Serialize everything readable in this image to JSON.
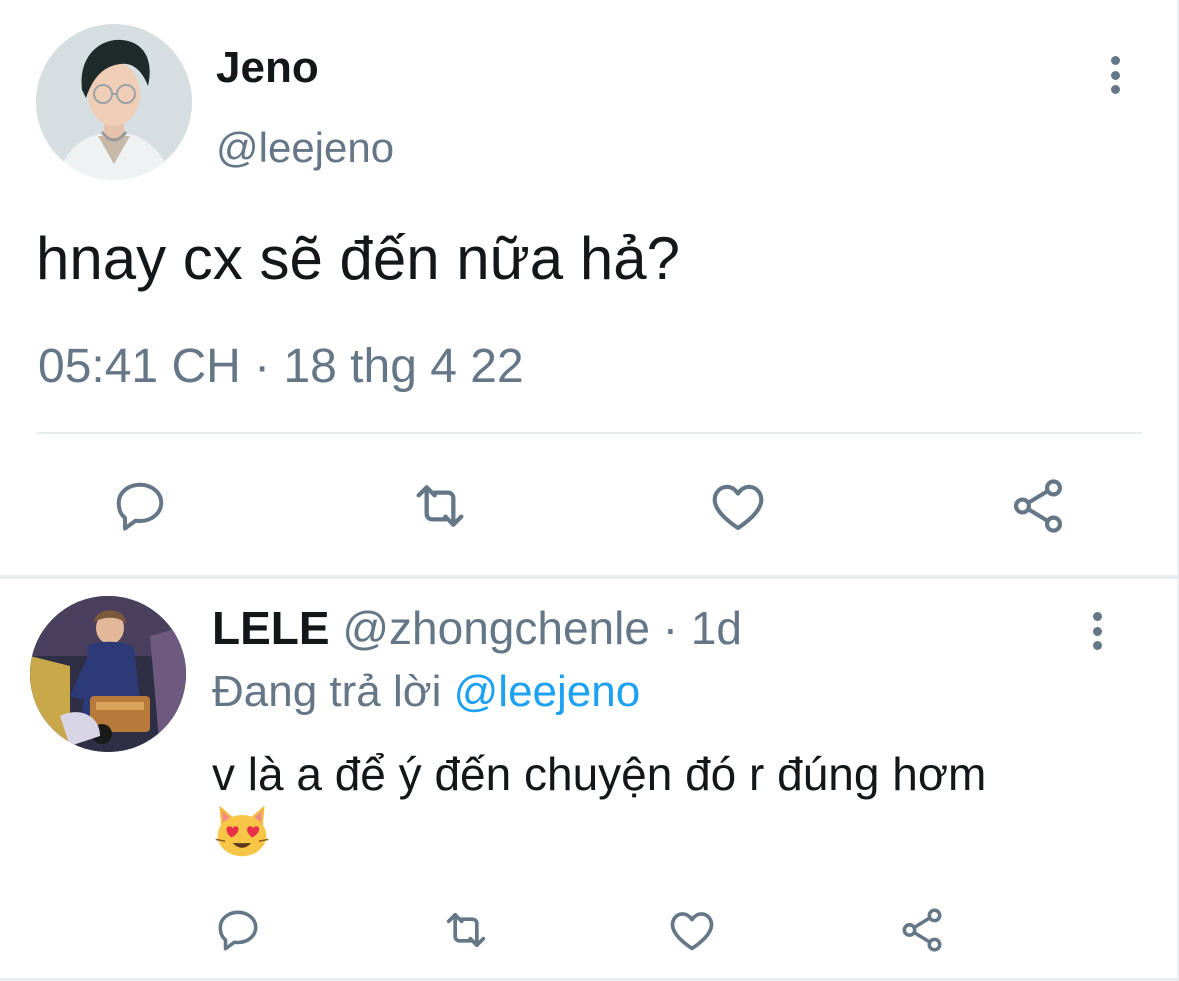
{
  "main_tweet": {
    "author_name": "Jeno",
    "author_handle": "@leejeno",
    "text": "hnay cx sẽ đến nữa hả?",
    "timestamp": "05:41 CH · 18 thg 4 22",
    "avatar_icon": "profile-photo",
    "actions": [
      "reply-icon",
      "retweet-icon",
      "like-icon",
      "share-icon"
    ]
  },
  "reply_tweet": {
    "author_name": "LELE",
    "author_handle": "@zhongchenle",
    "separator": " · ",
    "time_ago": "1d",
    "replying_prefix": "Đang trả lời ",
    "replying_to": "@leejeno",
    "text": "v là a để ý đến chuyện đó r đúng hơm",
    "emoji": "smiling-cat-heart-eyes",
    "avatar_icon": "profile-photo",
    "actions": [
      "reply-icon",
      "retweet-icon",
      "like-icon",
      "share-icon"
    ]
  },
  "colors": {
    "text_primary": "#14171a",
    "text_secondary": "#657786",
    "link": "#1da1f2",
    "divider": "#e6ecf0"
  }
}
